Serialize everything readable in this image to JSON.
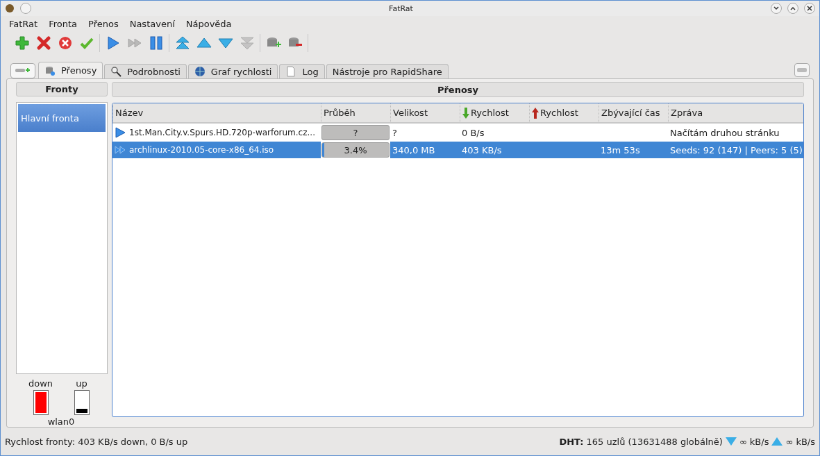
{
  "window": {
    "title": "FatRat"
  },
  "menu": [
    "FatRat",
    "Fronta",
    "Přenos",
    "Nastavení",
    "Nápověda"
  ],
  "toolbar": [
    [
      {
        "kind": "add",
        "disabled": false
      },
      {
        "kind": "remove",
        "disabled": false
      },
      {
        "kind": "delete",
        "disabled": false
      },
      {
        "kind": "check",
        "disabled": false
      }
    ],
    [
      {
        "kind": "play",
        "disabled": false
      },
      {
        "kind": "forward",
        "disabled": true
      },
      {
        "kind": "pause",
        "disabled": false
      }
    ],
    [
      {
        "kind": "top",
        "disabled": false
      },
      {
        "kind": "up",
        "disabled": false
      },
      {
        "kind": "down",
        "disabled": false
      },
      {
        "kind": "bottom",
        "disabled": true
      }
    ],
    [
      {
        "kind": "queue-add",
        "disabled": false
      },
      {
        "kind": "queue-remove",
        "disabled": false
      }
    ]
  ],
  "tabs": [
    {
      "label": "Přenosy",
      "kind": "transfers",
      "selected": true
    },
    {
      "label": "Podrobnosti",
      "kind": "details",
      "selected": false
    },
    {
      "label": "Graf rychlosti",
      "kind": "graph",
      "selected": false
    },
    {
      "label": "Log",
      "kind": "log",
      "selected": false
    },
    {
      "label": "Nástroje pro RapidShare",
      "kind": "none",
      "selected": false
    }
  ],
  "queues": {
    "header": "Fronty",
    "items": [
      {
        "label": "Hlavní fronta",
        "selected": true
      }
    ]
  },
  "meters": {
    "down": {
      "label": "down",
      "level": 1
    },
    "up": {
      "label": "up",
      "level": 0.2
    },
    "interface": "wlan0"
  },
  "transfers": {
    "header": "Přenosy",
    "columns": [
      {
        "label": "Název",
        "kind": "plain"
      },
      {
        "label": "Průběh",
        "kind": "plain"
      },
      {
        "label": "Velikost",
        "kind": "plain"
      },
      {
        "label": "Rychlost",
        "kind": "down"
      },
      {
        "label": "Rychlost",
        "kind": "up"
      },
      {
        "label": "Zbývající čas",
        "kind": "plain"
      },
      {
        "label": "Zpráva",
        "kind": "plain"
      }
    ],
    "rows": [
      {
        "kind": "active",
        "selected": false,
        "name": "1st.Man.City.v.Spurs.HD.720p-warforum.cz...",
        "progress": "?",
        "size": "?",
        "down": "0 B/s",
        "message": "Načítám druhou stránku"
      },
      {
        "kind": "forced",
        "selected": true,
        "name": "archlinux-2010.05-core-x86_64.iso",
        "progress": "3.4%",
        "level": 0.034,
        "size": "340,0 MB",
        "down": "403 KB/s",
        "remaining": "13m 53s",
        "message": "Seeds: 92 (147) | Peers: 5 (5)"
      }
    ]
  },
  "status": {
    "left": "Rychlost fronty: 403 KB/s down, 0 B/s up",
    "dht": "**DHT:** 165 uzlů (13631488 globálně)",
    "down": "∞ kB/s",
    "up": "∞ kB/s"
  }
}
